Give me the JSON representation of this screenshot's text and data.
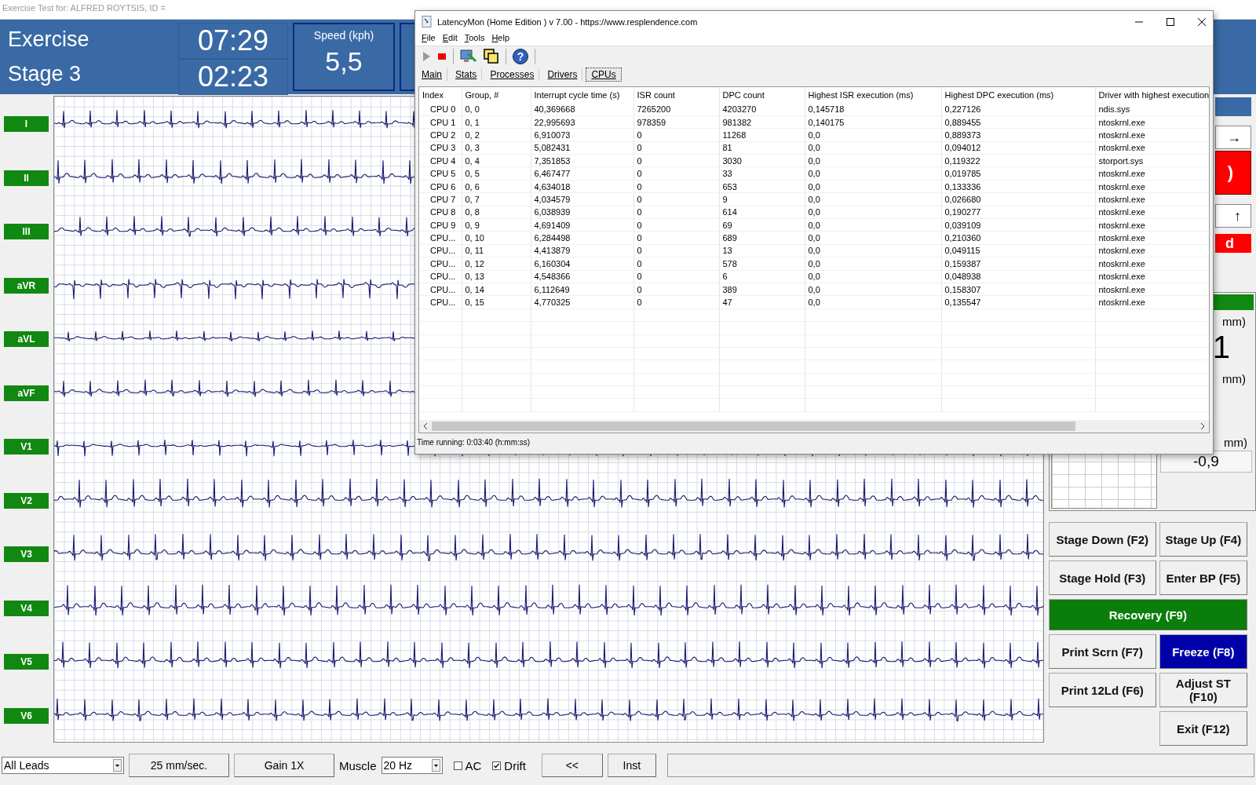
{
  "app_title": "Exercise Test for: ALFRED ROYTSIS, ID =",
  "header": {
    "mode": "Exercise",
    "stage": "Stage 3",
    "total_time": "07:29",
    "stage_time": "02:23",
    "speed_label": "Speed (kph)",
    "speed": "5,5"
  },
  "leads": [
    "I",
    "II",
    "III",
    "aVR",
    "aVL",
    "aVF",
    "V1",
    "V2",
    "V3",
    "V4",
    "V5",
    "V6"
  ],
  "side_panel": {
    "arrow_right": "→",
    "red_button": ")",
    "arrow_up": "↑",
    "red_bar": "d",
    "st_label_1": "mm)",
    "st_value": "1",
    "st_label_2": "mm)",
    "change_label": "mm)",
    "change_value": "-0,9"
  },
  "button_rows": [
    [
      {
        "label": "Stage Down (F2)",
        "kind": "gray"
      },
      {
        "label": "Stage Up (F4)",
        "kind": "gray"
      }
    ],
    [
      {
        "label": "Stage Hold (F3)",
        "kind": "gray"
      },
      {
        "label": "Enter BP (F5)",
        "kind": "gray"
      }
    ],
    [
      {
        "label": "Recovery (F9)",
        "kind": "green"
      }
    ],
    [
      {
        "label": "Print Scrn (F7)",
        "kind": "gray"
      },
      {
        "label": "Freeze (F8)",
        "kind": "blue"
      }
    ],
    [
      {
        "label": "Print 12Ld (F6)",
        "kind": "gray"
      },
      {
        "label": "Adjust ST (F10)",
        "kind": "gray"
      }
    ],
    [
      {
        "label": "Exit (F12)",
        "kind": "gray"
      }
    ]
  ],
  "bottom_bar": {
    "lead_select": "All Leads",
    "speed_button": "25 mm/sec.",
    "gain_button": "Gain 1X",
    "muscle_label": "Muscle",
    "muscle_select": "20 Hz",
    "checkboxes": [
      {
        "label": "AC",
        "checked": false
      },
      {
        "label": "Drift",
        "checked": true
      }
    ],
    "back_button": "<<",
    "inst_button": "Inst"
  },
  "latencymon": {
    "title": "LatencyMon  (Home Edition )  v 7.00 - https://www.resplendence.com",
    "menu": [
      "File",
      "Edit",
      "Tools",
      "Help"
    ],
    "help_glyph": "?",
    "tabs": [
      {
        "label": "Main",
        "selected": false
      },
      {
        "label": "Stats",
        "selected": false
      },
      {
        "label": "Processes",
        "selected": false
      },
      {
        "label": "Drivers",
        "selected": false
      },
      {
        "label": "CPUs",
        "selected": true
      }
    ],
    "columns": [
      "Index",
      "Group, #",
      "Interrupt cycle time (s)",
      "ISR count",
      "DPC count",
      "Highest ISR execution (ms)",
      "Highest DPC execution (ms)",
      "Driver with highest execution"
    ],
    "rows": [
      [
        "CPU 0",
        "0, 0",
        "40,369668",
        "7265200",
        "4203270",
        "0,145718",
        "0,227126",
        "ndis.sys"
      ],
      [
        "CPU 1",
        "0, 1",
        "22,995693",
        "978359",
        "981382",
        "0,140175",
        "0,889455",
        "ntoskrnl.exe"
      ],
      [
        "CPU 2",
        "0, 2",
        "6,910073",
        "0",
        "11268",
        "0,0",
        "0,889373",
        "ntoskrnl.exe"
      ],
      [
        "CPU 3",
        "0, 3",
        "5,082431",
        "0",
        "81",
        "0,0",
        "0,094012",
        "ntoskrnl.exe"
      ],
      [
        "CPU 4",
        "0, 4",
        "7,351853",
        "0",
        "3030",
        "0,0",
        "0,119322",
        "storport.sys"
      ],
      [
        "CPU 5",
        "0, 5",
        "6,467477",
        "0",
        "33",
        "0,0",
        "0,019785",
        "ntoskrnl.exe"
      ],
      [
        "CPU 6",
        "0, 6",
        "4,634018",
        "0",
        "653",
        "0,0",
        "0,133336",
        "ntoskrnl.exe"
      ],
      [
        "CPU 7",
        "0, 7",
        "4,034579",
        "0",
        "9",
        "0,0",
        "0,026680",
        "ntoskrnl.exe"
      ],
      [
        "CPU 8",
        "0, 8",
        "6,038939",
        "0",
        "614",
        "0,0",
        "0,190277",
        "ntoskrnl.exe"
      ],
      [
        "CPU 9",
        "0, 9",
        "4,691409",
        "0",
        "69",
        "0,0",
        "0,039109",
        "ntoskrnl.exe"
      ],
      [
        "CPU...",
        "0, 10",
        "6,284498",
        "0",
        "689",
        "0,0",
        "0,210360",
        "ntoskrnl.exe"
      ],
      [
        "CPU...",
        "0, 11",
        "4,413879",
        "0",
        "13",
        "0,0",
        "0,049115",
        "ntoskrnl.exe"
      ],
      [
        "CPU...",
        "0, 12",
        "6,160304",
        "0",
        "578",
        "0,0",
        "0,159387",
        "ntoskrnl.exe"
      ],
      [
        "CPU...",
        "0, 13",
        "4,548366",
        "0",
        "6",
        "0,0",
        "0,048938",
        "ntoskrnl.exe"
      ],
      [
        "CPU...",
        "0, 14",
        "6,112649",
        "0",
        "389",
        "0,0",
        "0,158307",
        "ntoskrnl.exe"
      ],
      [
        "CPU...",
        "0, 15",
        "4,770325",
        "0",
        "47",
        "0,0",
        "0,135547",
        "ntoskrnl.exe"
      ]
    ],
    "status": "Time running: 0:03:40  (h:mm:ss)"
  }
}
